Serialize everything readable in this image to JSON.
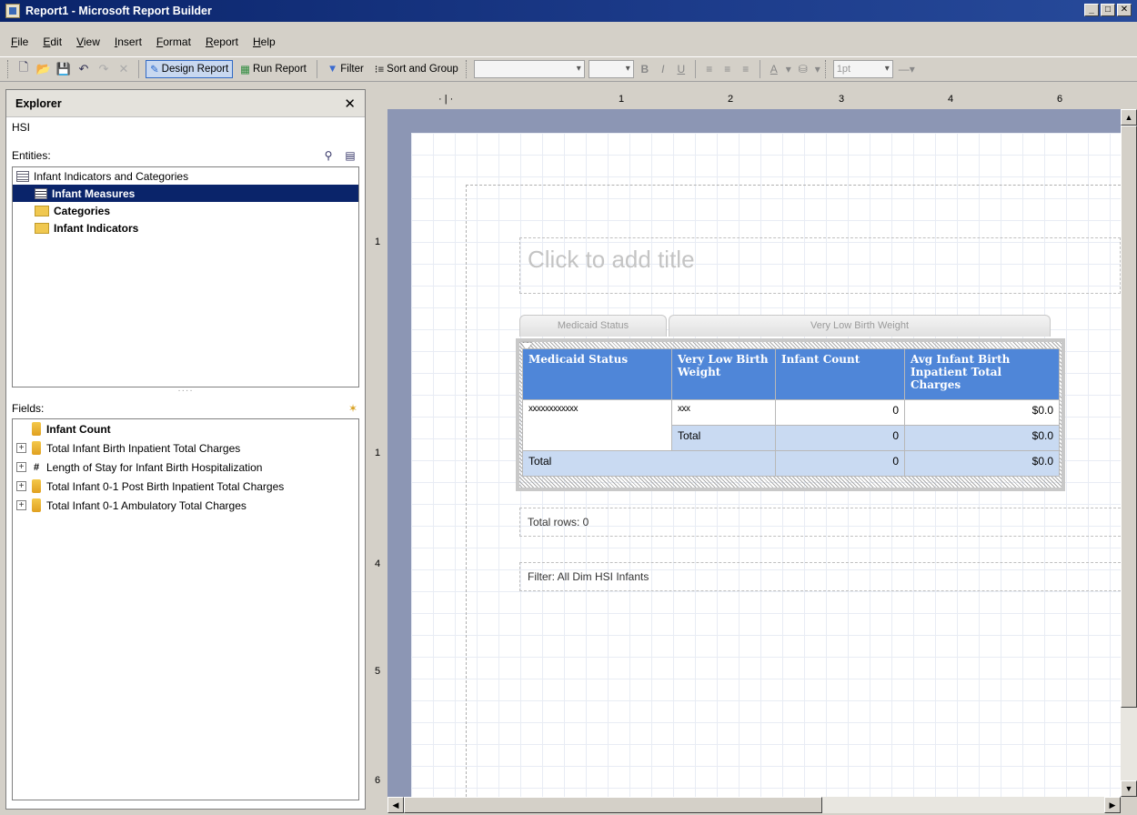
{
  "window": {
    "title": "Report1 - Microsoft Report Builder"
  },
  "menu": [
    "File",
    "Edit",
    "View",
    "Insert",
    "Format",
    "Report",
    "Help"
  ],
  "toolbar": {
    "design_report": "Design Report",
    "run_report": "Run Report",
    "filter": "Filter",
    "sort_group": "Sort and Group",
    "line_width": "1pt"
  },
  "explorer": {
    "title": "Explorer",
    "model": "HSI",
    "entities_label": "Entities:",
    "entities": {
      "root": "Infant Indicators and Categories",
      "children": [
        "Infant Measures",
        "Categories",
        "Infant Indicators"
      ]
    },
    "fields_label": "Fields:",
    "fields": [
      "Infant Count",
      "Total Infant Birth Inpatient Total Charges",
      "Length of Stay for Infant Birth Hospitalization",
      "Total Infant 0-1 Post Birth Inpatient Total Charges",
      "Total Infant 0-1 Ambulatory Total Charges"
    ]
  },
  "report": {
    "title_placeholder": "Click to add title",
    "row_group_header": "Medicaid Status",
    "col_group_header": "Very Low Birth Weight",
    "headers": [
      "Medicaid Status",
      "Very Low Birth Weight",
      "Infant Count",
      "Avg Infant Birth Inpatient Total Charges"
    ],
    "row1": [
      "xxxxxxxxxxxx",
      "xxx",
      "0",
      "$0.0"
    ],
    "row2": [
      "",
      "Total",
      "0",
      "$0.0"
    ],
    "row3": [
      "Total",
      "0",
      "$0.0"
    ],
    "total_rows": "Total rows: 0",
    "filter_text": "Filter: All Dim HSI Infants"
  },
  "ruler": {
    "top": [
      "1",
      "2",
      "3",
      "4",
      "6"
    ],
    "left": [
      "1",
      "1",
      "4",
      "5",
      "6"
    ]
  }
}
